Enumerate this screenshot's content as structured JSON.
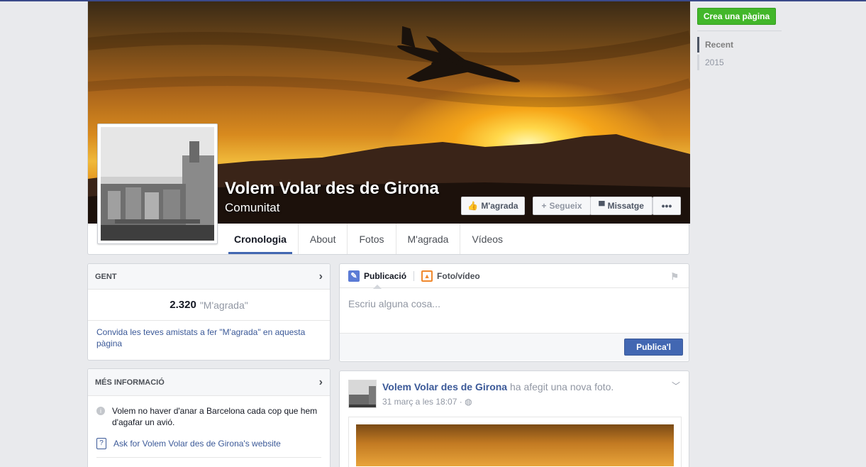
{
  "page": {
    "name": "Volem Volar des de Girona",
    "category": "Comunitat"
  },
  "cover_buttons": {
    "like": "M'agrada",
    "follow": "Segueix",
    "message": "Missatge",
    "more": "•••"
  },
  "tabs": [
    "Cronologia",
    "About",
    "Fotos",
    "M'agrada",
    "Vídeos"
  ],
  "right_column": {
    "create_page": "Crea una pàgina",
    "timeline": [
      "Recent",
      "2015"
    ]
  },
  "people_card": {
    "title": "GENT",
    "likes_count": "2.320",
    "likes_label": "\"M'agrada\"",
    "invite_text": "Convida les teves amistats a fer \"M'agrada\" en aquesta pàgina"
  },
  "about_card": {
    "title": "MÉS INFORMACIÓ",
    "description": "Volem no haver d'anar a Barcelona cada cop que hem d'agafar un avió.",
    "website_link": "Ask for Volem Volar des de Girona's website"
  },
  "composer": {
    "tab_post": "Publicació",
    "tab_photo": "Foto/vídeo",
    "placeholder": "Escriu alguna cosa...",
    "publish": "Publica'l"
  },
  "post": {
    "author": "Volem Volar des de Girona",
    "action": "ha afegit una nova foto.",
    "time": "31 març a les 18:07 · "
  },
  "colors": {
    "accent": "#4267b2",
    "link": "#3b5998",
    "create_button": "#42b72a"
  }
}
